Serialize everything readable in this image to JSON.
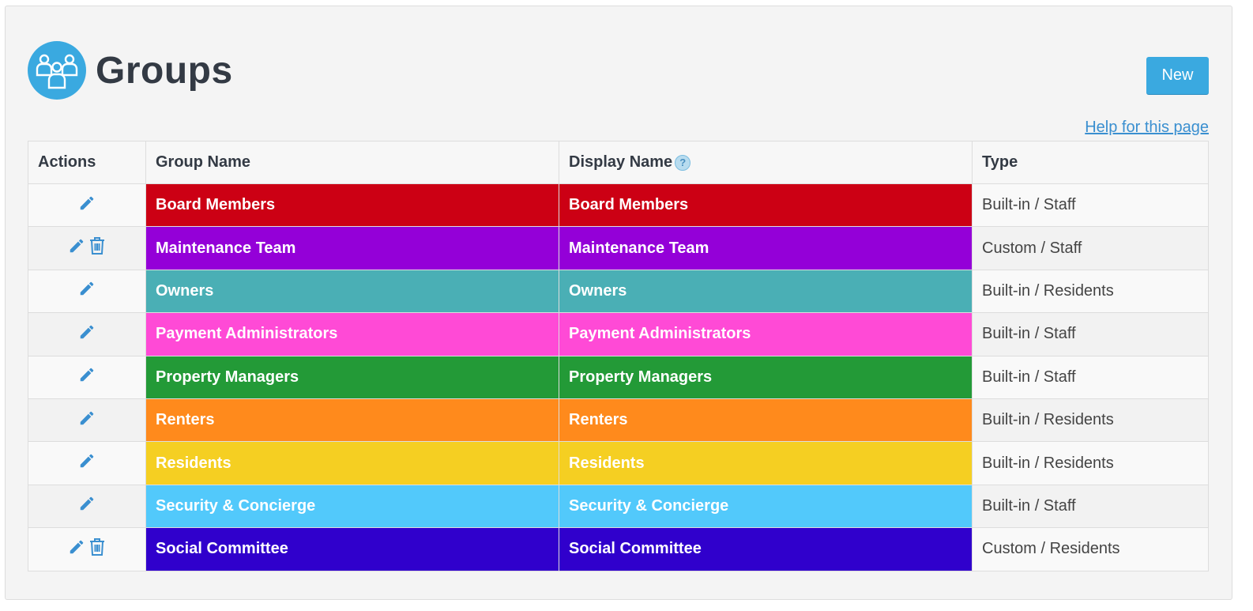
{
  "page": {
    "title": "Groups",
    "new_label": "New",
    "help_label": "Help for this page",
    "icon": "people-group-icon",
    "accent": "#3aa9e0"
  },
  "table": {
    "columns": [
      "Actions",
      "Group Name",
      "Display Name",
      "Type"
    ],
    "rows": [
      {
        "group_name": "Board Members",
        "display_name": "Board Members",
        "type": "Built-in / Staff",
        "color": "#cc0014",
        "deletable": false
      },
      {
        "group_name": "Maintenance Team",
        "display_name": "Maintenance Team",
        "type": "Custom / Staff",
        "color": "#9400d8",
        "deletable": true
      },
      {
        "group_name": "Owners",
        "display_name": "Owners",
        "type": "Built-in / Residents",
        "color": "#4aafb5",
        "deletable": false
      },
      {
        "group_name": "Payment Administrators",
        "display_name": "Payment Administrators",
        "type": "Built-in / Staff",
        "color": "#ff4ad6",
        "deletable": false
      },
      {
        "group_name": "Property Managers",
        "display_name": "Property Managers",
        "type": "Built-in / Staff",
        "color": "#239a37",
        "deletable": false
      },
      {
        "group_name": "Renters",
        "display_name": "Renters",
        "type": "Built-in / Residents",
        "color": "#ff8a1c",
        "deletable": false
      },
      {
        "group_name": "Residents",
        "display_name": "Residents",
        "type": "Built-in / Residents",
        "color": "#f5cf22",
        "deletable": false
      },
      {
        "group_name": "Security & Concierge",
        "display_name": "Security & Concierge",
        "type": "Built-in / Staff",
        "color": "#52c9fb",
        "deletable": false
      },
      {
        "group_name": "Social Committee",
        "display_name": "Social Committee",
        "type": "Custom / Residents",
        "color": "#3000cc",
        "deletable": true
      }
    ]
  }
}
